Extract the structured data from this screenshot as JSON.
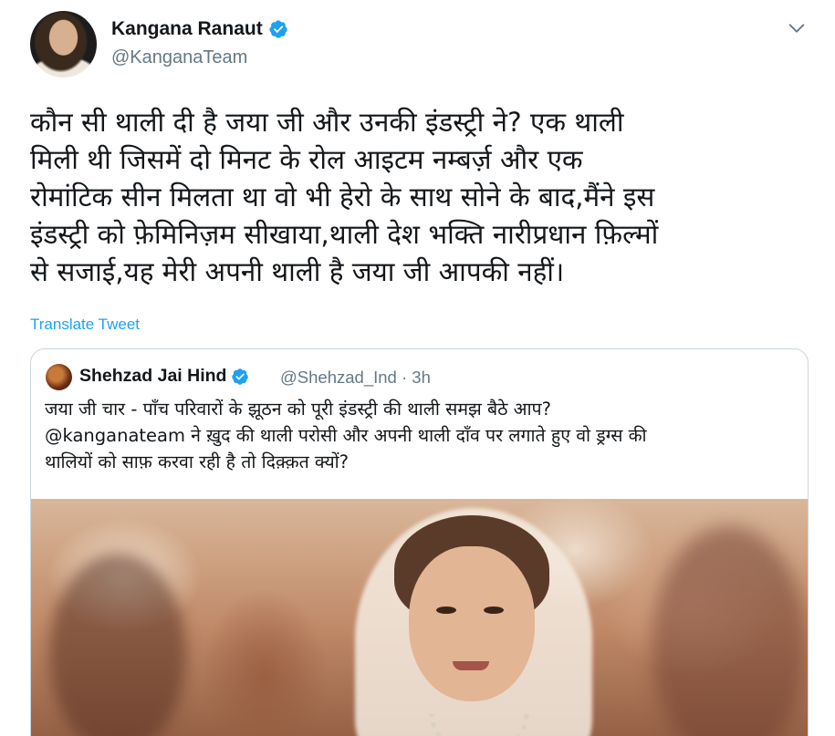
{
  "tweet": {
    "author": {
      "name": "Kangana Ranaut",
      "handle": "@KanganaTeam",
      "verified": true
    },
    "text": "कौन सी थाली दी है जया जी और उनकी इंडस्ट्री ने? एक थाली\nमिली थी जिसमें दो मिनट के रोल आइटम नम्बर्ज़ और एक\nरोमांटिक सीन मिलता था वो भी हेरो के साथ सोने के बाद,मैंने इस\nइंडस्ट्री को फ़ेमिनिज़म सीखाया,थाली देश भक्ति नारीप्रधान फ़िल्मों\nसे सजाई,यह मेरी अपनी थाली है जया जी आपकी नहीं।",
    "translate_label": "Translate Tweet",
    "quoted": {
      "author_name": "Shehzad Jai Hind",
      "handle": "@Shehzad_Ind",
      "separator": "·",
      "time": "3h",
      "verified": true,
      "text": "जया जी चार - पाँच परिवारों के झूठन को पूरी इंडस्ट्री की थाली समझ बैठे आप?\n@kanganateam ने ख़ुद की थाली परोसी और अपनी थाली दाँव पर लगाते हुए वो ड्रग्स की\nथालियों को साफ़ करवा रही है तो दिक़्क़त क्यों?"
    }
  },
  "colors": {
    "accent": "#1da1f2",
    "secondary_text": "#657786",
    "primary_text": "#14171a",
    "border": "#ccd6dd"
  },
  "icons": {
    "verified": "verified-badge-icon",
    "chevron": "chevron-down-icon"
  }
}
